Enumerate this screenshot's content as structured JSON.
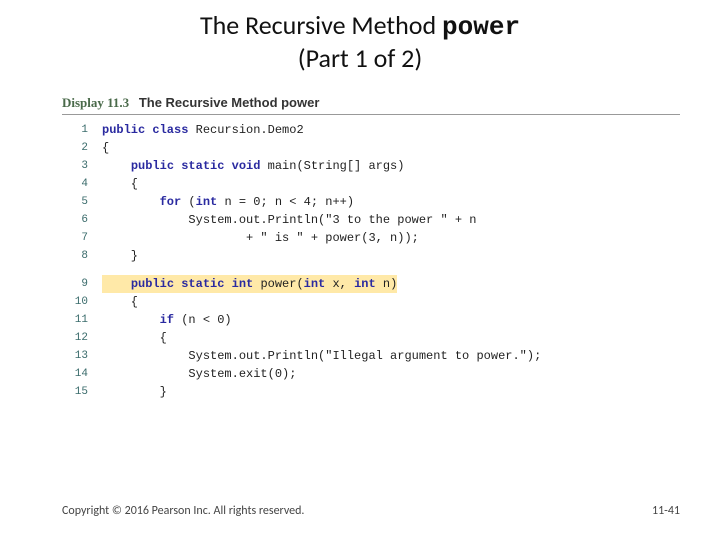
{
  "title": {
    "line1_pre": "The Recursive Method ",
    "line1_mono": "power",
    "line2": "(Part 1 of 2)"
  },
  "display": {
    "label": "Display 11.3",
    "title": "The Recursive Method power"
  },
  "code": {
    "lines": [
      {
        "n": "1",
        "segs": [
          [
            "kw",
            "public class "
          ],
          [
            "plain",
            "Recursion.Demo2"
          ]
        ]
      },
      {
        "n": "2",
        "segs": [
          [
            "plain",
            "{"
          ]
        ]
      },
      {
        "n": "3",
        "segs": [
          [
            "plain",
            "    "
          ],
          [
            "kw",
            "public static void "
          ],
          [
            "plain",
            "main(String[] args)"
          ]
        ]
      },
      {
        "n": "4",
        "segs": [
          [
            "plain",
            "    {"
          ]
        ]
      },
      {
        "n": "5",
        "segs": [
          [
            "plain",
            "        "
          ],
          [
            "kw",
            "for "
          ],
          [
            "plain",
            "("
          ],
          [
            "kw",
            "int "
          ],
          [
            "plain",
            "n = 0; n < 4; n++)"
          ]
        ]
      },
      {
        "n": "6",
        "segs": [
          [
            "plain",
            "            System.out.Println(\"3 to the power \" + n"
          ]
        ]
      },
      {
        "n": "7",
        "segs": [
          [
            "plain",
            "                    + \" is \" + power(3, n));"
          ]
        ]
      },
      {
        "n": "8",
        "segs": [
          [
            "plain",
            "    }"
          ]
        ]
      },
      {
        "gap": true
      },
      {
        "n": "9",
        "hl": true,
        "segs": [
          [
            "plain",
            "    "
          ],
          [
            "kw",
            "public static int "
          ],
          [
            "plain",
            "power("
          ],
          [
            "kw",
            "int "
          ],
          [
            "plain",
            "x, "
          ],
          [
            "kw",
            "int"
          ],
          [
            "plain",
            " n)"
          ]
        ]
      },
      {
        "n": "10",
        "segs": [
          [
            "plain",
            "    {"
          ]
        ]
      },
      {
        "n": "11",
        "segs": [
          [
            "plain",
            "        "
          ],
          [
            "kw",
            "if "
          ],
          [
            "plain",
            "(n < 0)"
          ]
        ]
      },
      {
        "n": "12",
        "segs": [
          [
            "plain",
            "        {"
          ]
        ]
      },
      {
        "n": "13",
        "segs": [
          [
            "plain",
            "            System.out.Println(\"Illegal argument to power.\");"
          ]
        ]
      },
      {
        "n": "14",
        "segs": [
          [
            "plain",
            "            System.exit(0);"
          ]
        ]
      },
      {
        "n": "15",
        "segs": [
          [
            "plain",
            "        }"
          ]
        ]
      }
    ]
  },
  "footer": {
    "left": "Copyright © 2016 Pearson Inc. All rights reserved.",
    "right": "11-41"
  }
}
